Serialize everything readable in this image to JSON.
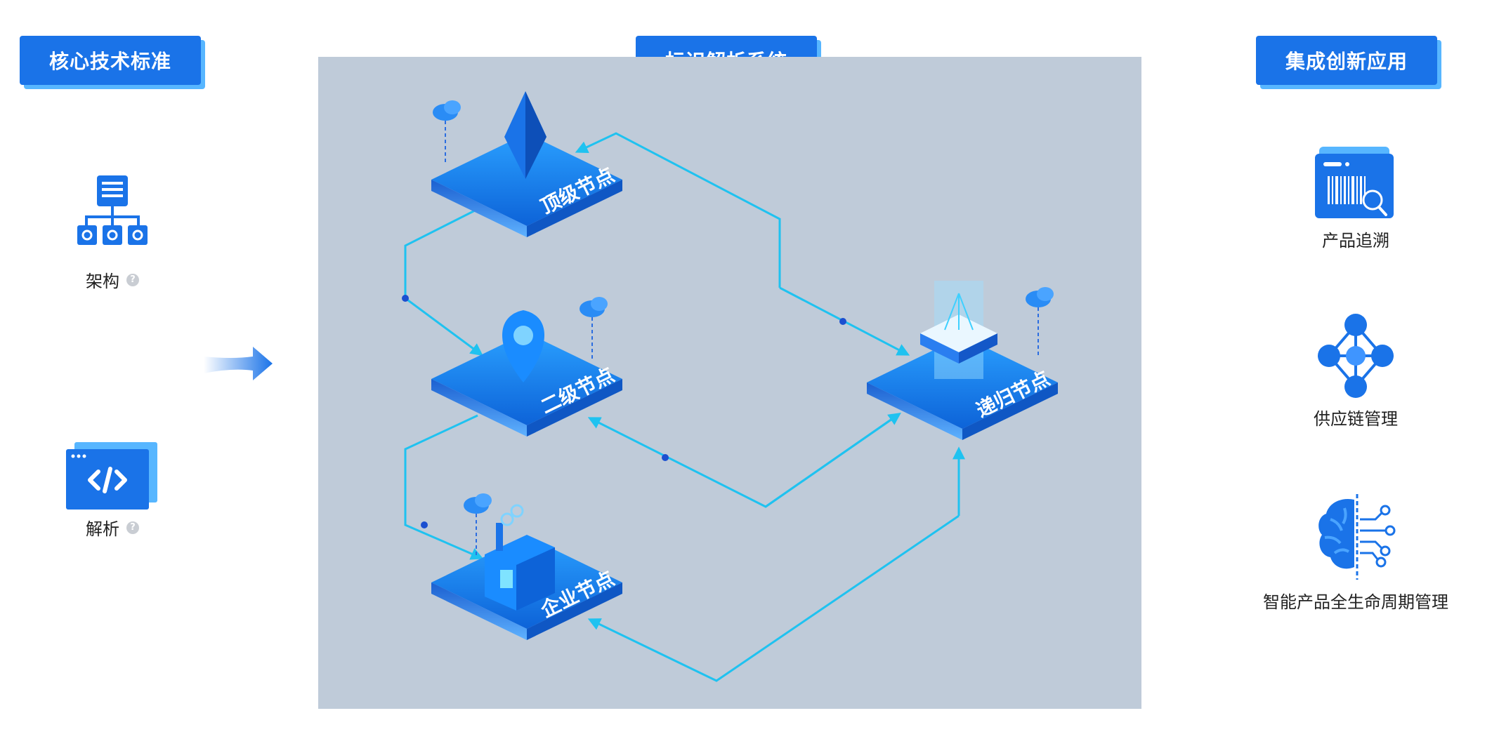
{
  "headers": {
    "left": "核心技术标准",
    "center": "标识解析系统",
    "right": "集成创新应用"
  },
  "left_items": [
    {
      "label": "架构",
      "icon": "hierarchy-icon"
    },
    {
      "label": "解析",
      "icon": "code-window-icon"
    }
  ],
  "right_items": [
    {
      "label": "产品追溯",
      "icon": "barcode-search-icon"
    },
    {
      "label": "供应链管理",
      "icon": "network-nodes-icon"
    },
    {
      "label": "智能产品全生命周期管理",
      "icon": "ai-brain-icon"
    }
  ],
  "nodes": {
    "top": "顶级节点",
    "secondary": "二级节点",
    "enterprise": "企业节点",
    "recursive": "递归节点"
  },
  "colors": {
    "primary": "#1a73e8",
    "accent": "#57b6ff",
    "panel": "#bfcbd9",
    "line": "#1fc2f0"
  }
}
